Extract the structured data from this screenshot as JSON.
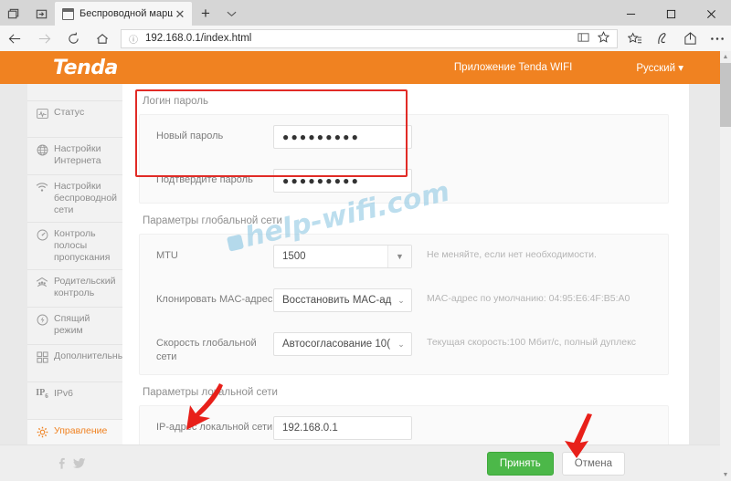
{
  "browser": {
    "tab": {
      "title": "Беспроводной маршру",
      "favicon": "window-icon",
      "close": "✕"
    },
    "new_tab_label": "+",
    "tab_list_icon": "chevron-down-icon",
    "sys_icons": [
      "task-view-icon",
      "new-window-icon"
    ],
    "window_controls": {
      "minimize": "—",
      "maximize": "☐",
      "close": "✕"
    },
    "nav": {
      "back": "←",
      "forward": "→",
      "refresh": "↻",
      "home": "⌂"
    },
    "url": {
      "value": "192.168.0.1/index.html",
      "info_icon": "info-icon"
    },
    "url_icons": [
      "reading-view-icon",
      "favorite-star-icon"
    ],
    "toolbar_icons": [
      "favorites-hub-icon",
      "web-notes-icon",
      "share-icon",
      "more-icon"
    ]
  },
  "header": {
    "logo": "Tenda",
    "app_link": "Приложение Tenda WIFI",
    "language": "Русский ▾"
  },
  "colors": {
    "brand_orange": "#f08221",
    "accent_active": "#f08221",
    "primary_button": "#4cb849",
    "highlight_border": "#e12b26",
    "annotation": "#e8201a"
  },
  "sidebar": {
    "items": [
      {
        "label": "Статус",
        "icon": "status-pulse-icon",
        "active": false
      },
      {
        "label": "Настройки Интернета",
        "icon": "globe-icon",
        "active": false
      },
      {
        "label": "Настройки беспроводной сети",
        "icon": "wifi-icon",
        "active": false
      },
      {
        "label": "Контроль полосы пропускания",
        "icon": "gauge-icon",
        "active": false
      },
      {
        "label": "Родительский контроль",
        "icon": "family-icon",
        "active": false
      },
      {
        "label": "Спящий режим",
        "icon": "sleep-moon-icon",
        "active": false
      },
      {
        "label": "Дополнительные",
        "icon": "grid-squares-icon",
        "active": false
      },
      {
        "label": "IPv6",
        "icon": "ipv6-icon",
        "active": false
      },
      {
        "label": "Управление",
        "icon": "gear-icon",
        "active": true
      }
    ]
  },
  "main": {
    "sections": [
      {
        "title": "Логин пароль",
        "highlighted": true,
        "rows": [
          {
            "label": "Новый пароль",
            "type": "password",
            "value": "●●●●●●●●●",
            "hint": ""
          },
          {
            "label": "Подтвердите пароль",
            "type": "password",
            "value": "●●●●●●●●●",
            "hint": ""
          }
        ]
      },
      {
        "title": "Параметры глобальной сети",
        "highlighted": false,
        "rows": [
          {
            "label": "MTU",
            "type": "select-box",
            "value": "1500",
            "hint": "Не меняйте, если нет необходимости."
          },
          {
            "label": "Клонировать MAC-адрес",
            "type": "select",
            "value": "Восстановить MAC-ад",
            "hint": "MAC-адрес по умолчанию: 04:95:E6:4F:B5:A0"
          },
          {
            "label": "Скорость глобальной сети",
            "type": "select",
            "value": "Автосогласование 10(",
            "hint": "Текущая скорость:100 Мбит/с, полный дуплекс"
          }
        ]
      },
      {
        "title": "Параметры локальной сети",
        "highlighted": false,
        "rows": [
          {
            "label": "IP-адрес локальной сети",
            "type": "text",
            "value": "192.168.0.1",
            "hint": ""
          }
        ]
      }
    ],
    "watermark": "help-wifi.com"
  },
  "footer": {
    "social": [
      "facebook-icon",
      "twitter-icon"
    ],
    "apply_label": "Принять",
    "cancel_label": "Отмена"
  },
  "scrollbar": {
    "up": "▲",
    "down": "▼"
  }
}
